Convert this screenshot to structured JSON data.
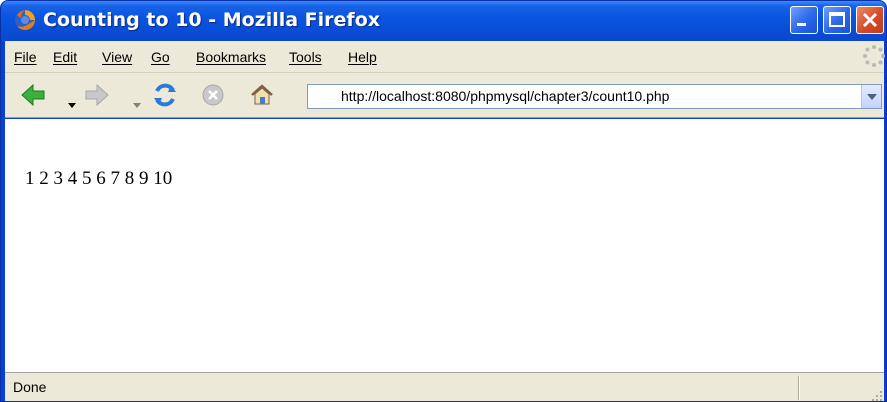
{
  "window": {
    "title": "Counting to 10 - Mozilla Firefox"
  },
  "menu": {
    "items": [
      "File",
      "Edit",
      "View",
      "Go",
      "Bookmarks",
      "Tools",
      "Help"
    ]
  },
  "nav": {
    "url": "http://localhost:8080/phpmysql/chapter3/count10.php"
  },
  "page": {
    "content": "1 2 3 4 5 6 7 8 9 10"
  },
  "status": {
    "text": "Done"
  },
  "colors": {
    "titlebar": "#0a55e0",
    "chrome": "#ece9d8",
    "close_button": "#d44a2a"
  }
}
